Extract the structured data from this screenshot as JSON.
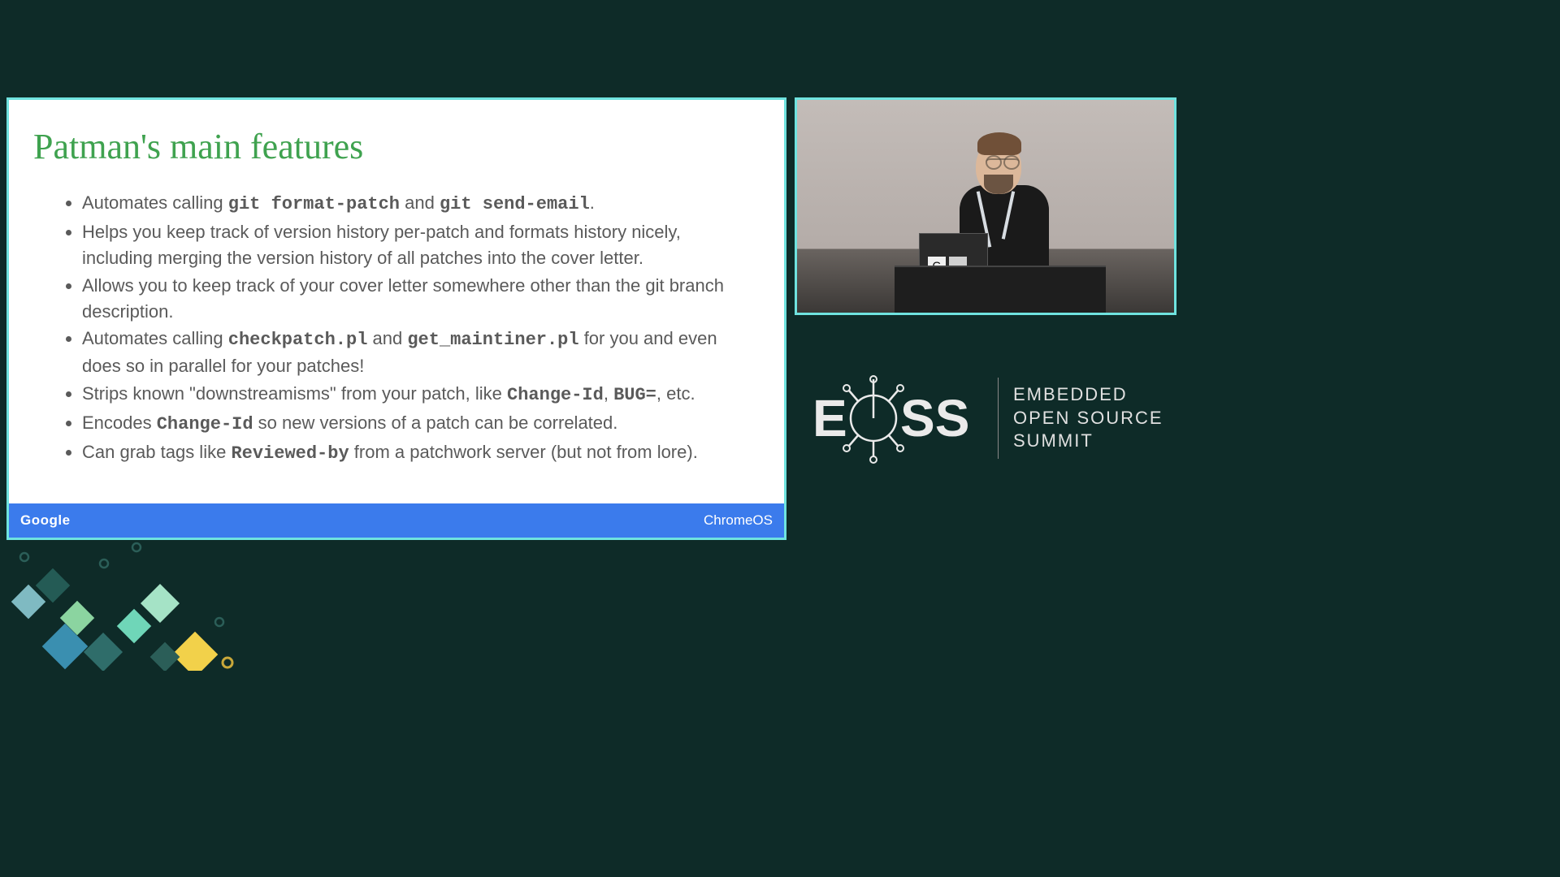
{
  "slide": {
    "title": "Patman's main features",
    "bullets_html": [
      "Automates calling <code>git format-patch</code> and <code>git send-email</code>.",
      "Helps you keep track of version history per-patch and formats history nicely, including merging the version history of all patches into the cover letter.",
      "Allows you to keep track of your cover letter somewhere other than the git branch description.",
      "Automates calling <code>checkpatch.pl</code> and <code>get_maintiner.pl</code> for you and even does so in parallel for your patches!",
      "Strips known \"downstreamisms\" from your patch, like <code>Change-Id</code>, <code>BUG=</code>, etc.",
      "Encodes <code>Change-Id</code> so new versions of a patch can be correlated.",
      "Can grab tags like <code>Reviewed-by</code> from a patchwork server (but not from lore)."
    ],
    "footer_left": "Google",
    "footer_right": "ChromeOS"
  },
  "logo": {
    "letters": "EOSS",
    "line1": "EMBEDDED",
    "line2": "OPEN SOURCE",
    "line3": "SUMMIT"
  }
}
